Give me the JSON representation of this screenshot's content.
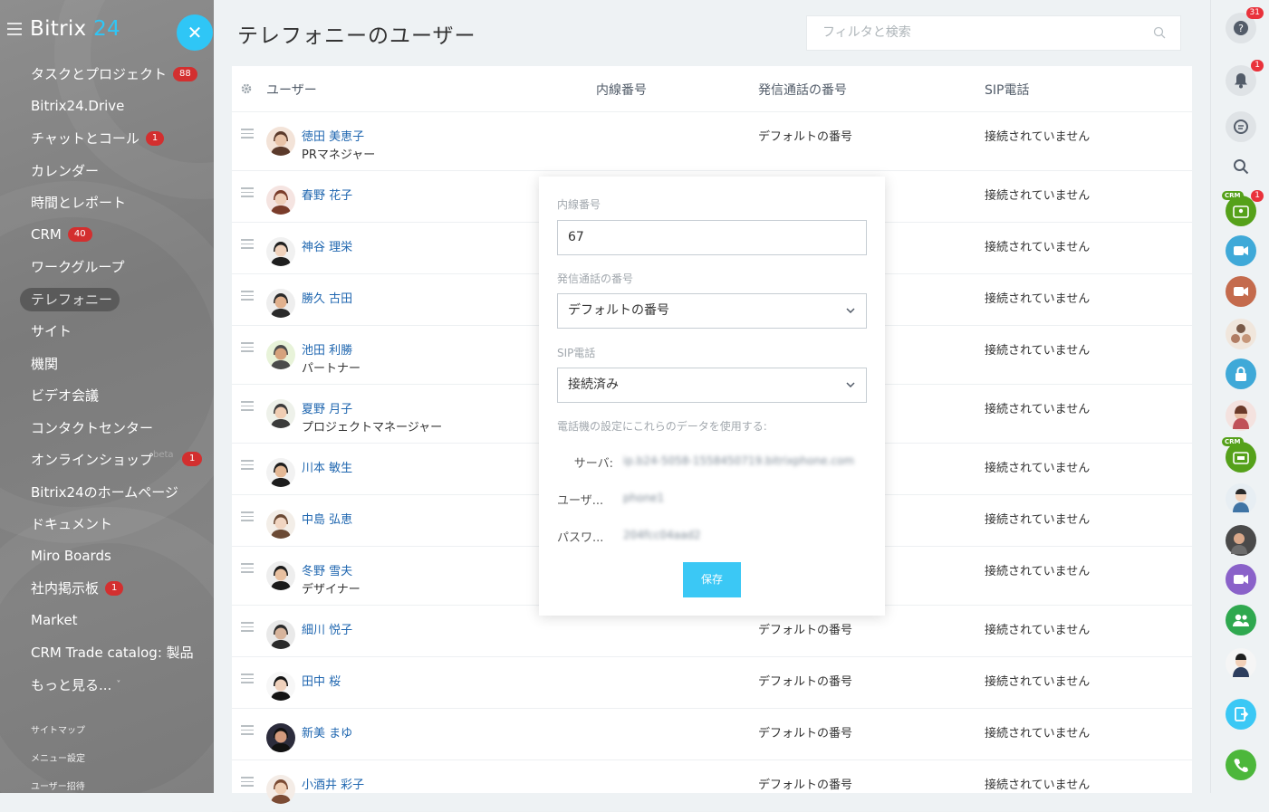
{
  "sidebar": {
    "logo_text": "Bitrix",
    "logo_num": "24",
    "items": [
      {
        "label": "タスクとプロジェクト",
        "count": "88"
      },
      {
        "label": "Bitrix24.Drive"
      },
      {
        "label": "チャットとコール",
        "count": "1"
      },
      {
        "label": "カレンダー"
      },
      {
        "label": "時間とレポート"
      },
      {
        "label": "CRM",
        "count": "40"
      },
      {
        "label": "ワークグループ"
      },
      {
        "label": "テレフォニー",
        "active": true
      },
      {
        "label": "サイト"
      },
      {
        "label": "機関"
      },
      {
        "label": "ビデオ会議"
      },
      {
        "label": "コンタクトセンター"
      },
      {
        "label": "オンラインショップ",
        "beta": "beta",
        "count": "1"
      },
      {
        "label": "Bitrix24のホームページ"
      },
      {
        "label": "ドキュメント"
      },
      {
        "label": "Miro Boards"
      },
      {
        "label": "社内掲示板",
        "count": "1"
      },
      {
        "label": "Market"
      },
      {
        "label": "CRM Trade catalog: 製品"
      },
      {
        "label": "もっと見る...",
        "more": "˅"
      }
    ],
    "footer": [
      "サイトマップ",
      "メニュー設定",
      "ユーザー招待"
    ]
  },
  "header": {
    "title": "テレフォニーのユーザー",
    "search_placeholder": "フィルタと検索"
  },
  "table": {
    "columns": [
      "ユーザー",
      "内線番号",
      "発信通話の番号",
      "SIP電話"
    ],
    "rows": [
      {
        "name": "徳田 美恵子",
        "position": "PRマネジャー",
        "phone": "デフォルトの番号",
        "sip": "接続されていません"
      },
      {
        "name": "春野 花子",
        "position": "",
        "phone": "",
        "sip": "接続されていません"
      },
      {
        "name": "神谷 理栄",
        "position": "",
        "phone": "",
        "sip": "接続されていません"
      },
      {
        "name": "勝久 古田",
        "position": "",
        "phone": "",
        "sip": "接続されていません"
      },
      {
        "name": "池田 利勝",
        "position": "パートナー",
        "phone": "",
        "sip": "接続されていません"
      },
      {
        "name": "夏野 月子",
        "position": "プロジェクトマネージャー",
        "phone": "",
        "sip": "接続されていません"
      },
      {
        "name": "川本 敏生",
        "position": "",
        "phone": "",
        "sip": "接続されていません"
      },
      {
        "name": "中島 弘恵",
        "position": "",
        "phone": "",
        "sip": "接続されていません"
      },
      {
        "name": "冬野 雪夫",
        "position": "デザイナー",
        "phone": "",
        "sip": "接続されていません"
      },
      {
        "name": "細川 悦子",
        "position": "",
        "phone": "デフォルトの番号",
        "sip": "接続されていません"
      },
      {
        "name": "田中 桜",
        "position": "",
        "phone": "デフォルトの番号",
        "sip": "接続されていません"
      },
      {
        "name": "新美 まゆ",
        "position": "",
        "phone": "デフォルトの番号",
        "sip": "接続されていません"
      },
      {
        "name": "小酒井 彩子",
        "position": "",
        "phone": "デフォルトの番号",
        "sip": "接続されていません"
      }
    ]
  },
  "popup": {
    "ext_label": "内線番号",
    "ext_value": "67",
    "outgoing_label": "発信通話の番号",
    "outgoing_value": "デフォルトの番号",
    "sip_label": "SIP電話",
    "sip_value": "接続済み",
    "hint": "電話機の設定にこれらのデータを使用する:",
    "server_label": "サーバ:",
    "server_value": "ip.b24-5058-1558450719.bitrixphone.com",
    "user_label": "ユーザ...",
    "user_value": "phone1",
    "pass_label": "パスワ...",
    "pass_value": "204fcc04aad2",
    "save_label": "保存"
  },
  "rightbar": {
    "help_badge": "31",
    "notify_badge": "1",
    "crm_badge": "1",
    "crm_tag": "CRM"
  },
  "colors": {
    "accent": "#2fc6f6",
    "badge": "#d32f2f",
    "link": "#2067b0",
    "save": "#3bc8f5"
  }
}
